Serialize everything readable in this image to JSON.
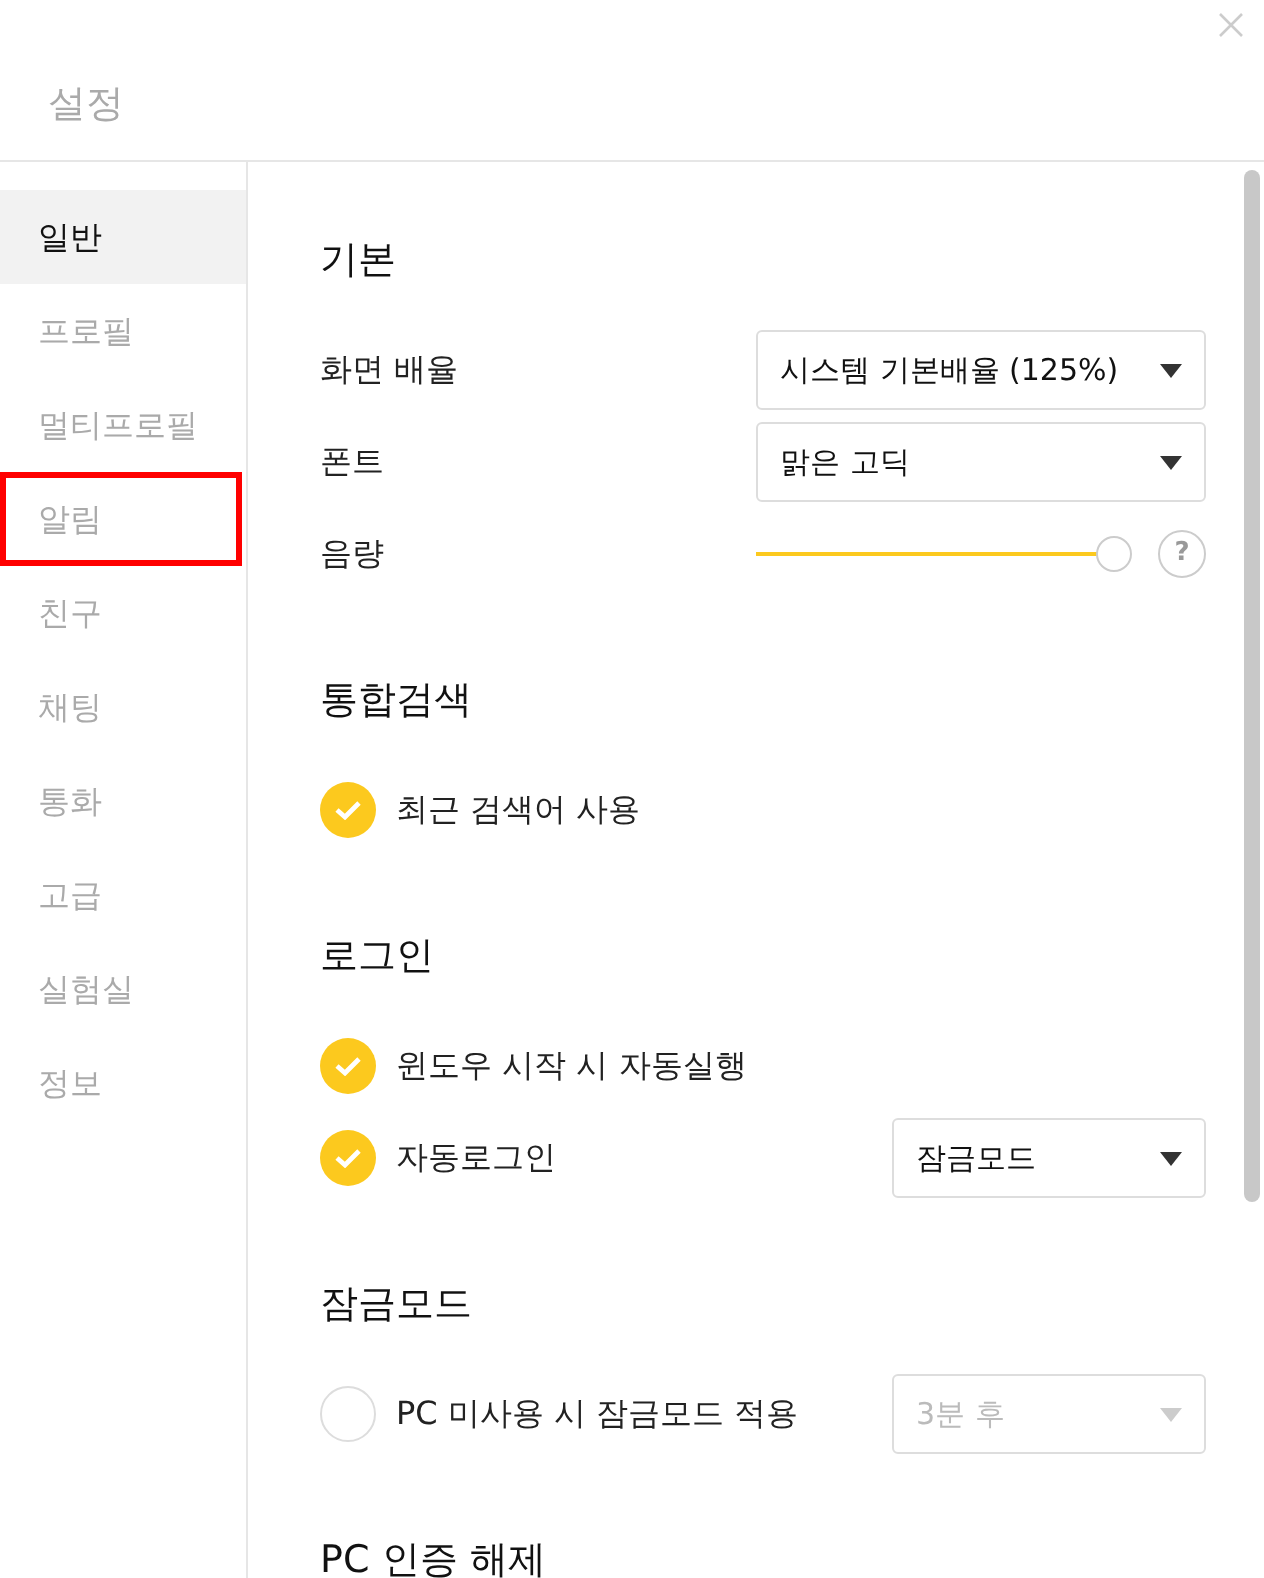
{
  "window": {
    "title": "설정"
  },
  "sidebar": {
    "items": [
      {
        "label": "일반",
        "selected": true,
        "highlighted": false
      },
      {
        "label": "프로필",
        "selected": false,
        "highlighted": false
      },
      {
        "label": "멀티프로필",
        "selected": false,
        "highlighted": false
      },
      {
        "label": "알림",
        "selected": false,
        "highlighted": true
      },
      {
        "label": "친구",
        "selected": false,
        "highlighted": false
      },
      {
        "label": "채팅",
        "selected": false,
        "highlighted": false
      },
      {
        "label": "통화",
        "selected": false,
        "highlighted": false
      },
      {
        "label": "고급",
        "selected": false,
        "highlighted": false
      },
      {
        "label": "실험실",
        "selected": false,
        "highlighted": false
      },
      {
        "label": "정보",
        "selected": false,
        "highlighted": false
      }
    ]
  },
  "sections": [
    {
      "title": "기본",
      "rows": [
        {
          "kind": "select",
          "label": "화면 배율",
          "value": "시스템 기본배율 (125%)",
          "disabled": false
        },
        {
          "kind": "select",
          "label": "폰트",
          "value": "맑은 고딕",
          "disabled": false
        },
        {
          "kind": "slider",
          "label": "음량",
          "level": 1,
          "help": "?"
        }
      ]
    },
    {
      "title": "통합검색",
      "rows": [
        {
          "kind": "checkbox",
          "label": "최근 검색어 사용",
          "checked": true
        }
      ]
    },
    {
      "title": "로그인",
      "rows": [
        {
          "kind": "checkbox",
          "label": "윈도우 시작 시 자동실행",
          "checked": true
        },
        {
          "kind": "checkbox",
          "label": "자동로그인",
          "checked": true,
          "select": {
            "value": "잠금모드",
            "disabled": false
          }
        }
      ]
    },
    {
      "title": "잠금모드",
      "rows": [
        {
          "kind": "checkbox",
          "label": "PC 미사용 시 잠금모드 적용",
          "checked": false,
          "select": {
            "value": "3분 후",
            "disabled": true
          }
        }
      ]
    },
    {
      "title": "PC 인증 해제"
    }
  ]
}
